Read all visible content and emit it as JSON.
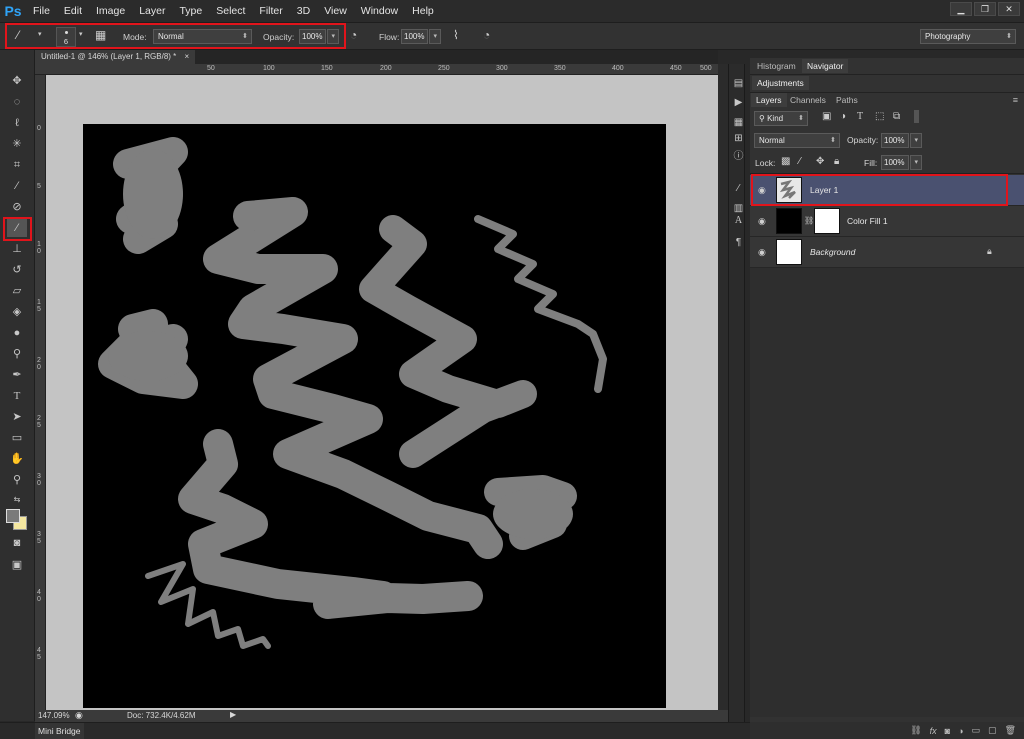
{
  "app": {
    "logo": "Ps"
  },
  "menu": [
    "File",
    "Edit",
    "Image",
    "Layer",
    "Type",
    "Select",
    "Filter",
    "3D",
    "View",
    "Window",
    "Help"
  ],
  "window_controls": {
    "minimize": "▁",
    "restore": "❐",
    "close": "✕"
  },
  "options": {
    "brush_size": "6",
    "mode_label": "Mode:",
    "mode_value": "Normal",
    "opacity_label": "Opacity:",
    "opacity_value": "100%",
    "flow_label": "Flow:",
    "flow_value": "100%",
    "workspace": "Photography"
  },
  "document": {
    "tab_title": "Untitled-1 @ 146% (Layer 1, RGB/8) *",
    "close": "×"
  },
  "ruler_top": [
    "50",
    "100",
    "150",
    "200",
    "250",
    "300",
    "350",
    "400",
    "450",
    "500"
  ],
  "ruler_left": [
    "0",
    "5",
    "1 0",
    "1 5",
    "2 0",
    "2 5",
    "3 0",
    "3 5",
    "4 0",
    "4 5"
  ],
  "status": {
    "zoom": "147.09%",
    "doc": "Doc: 732.4K/4.62M"
  },
  "minibridge": "Mini Bridge",
  "panels": {
    "top_tabs": [
      "Histogram",
      "Navigator"
    ],
    "adjustments": "Adjustments",
    "layer_tabs": [
      "Layers",
      "Channels",
      "Paths"
    ],
    "kind": "Kind",
    "blend_mode": "Normal",
    "opacity_label": "Opacity:",
    "opacity_value": "100%",
    "lock_label": "Lock:",
    "fill_label": "Fill:",
    "fill_value": "100%",
    "layers": [
      {
        "name": "Layer 1",
        "selected": true
      },
      {
        "name": "Color Fill 1",
        "selected": false
      },
      {
        "name": "Background",
        "selected": false
      }
    ]
  },
  "colors": {
    "highlight": "#e1141b",
    "selected_layer": "#4a5170",
    "stroke": "#7f7f7f"
  }
}
